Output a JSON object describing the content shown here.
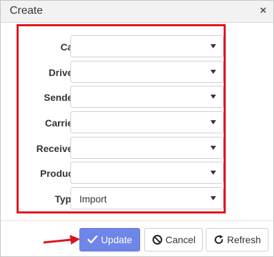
{
  "dialog": {
    "title": "Create",
    "close_glyph": "×"
  },
  "form": {
    "fields": [
      {
        "label": "Car",
        "value": ""
      },
      {
        "label": "Driver",
        "value": ""
      },
      {
        "label": "Sender",
        "value": ""
      },
      {
        "label": "Carrier",
        "value": ""
      },
      {
        "label": "Receiver",
        "value": ""
      },
      {
        "label": "Product",
        "value": ""
      },
      {
        "label": "Type",
        "value": "Import"
      }
    ]
  },
  "footer": {
    "update_label": "Update",
    "cancel_label": "Cancel",
    "refresh_label": "Refresh"
  },
  "icons": {
    "update": "check-icon",
    "cancel": "ban-icon",
    "refresh": "refresh-icon",
    "dropdown": "chevron-down-icon"
  },
  "colors": {
    "highlight_border": "#e0121b",
    "primary_button": "#6f86e8",
    "annotation_arrow": "#e0121b"
  }
}
